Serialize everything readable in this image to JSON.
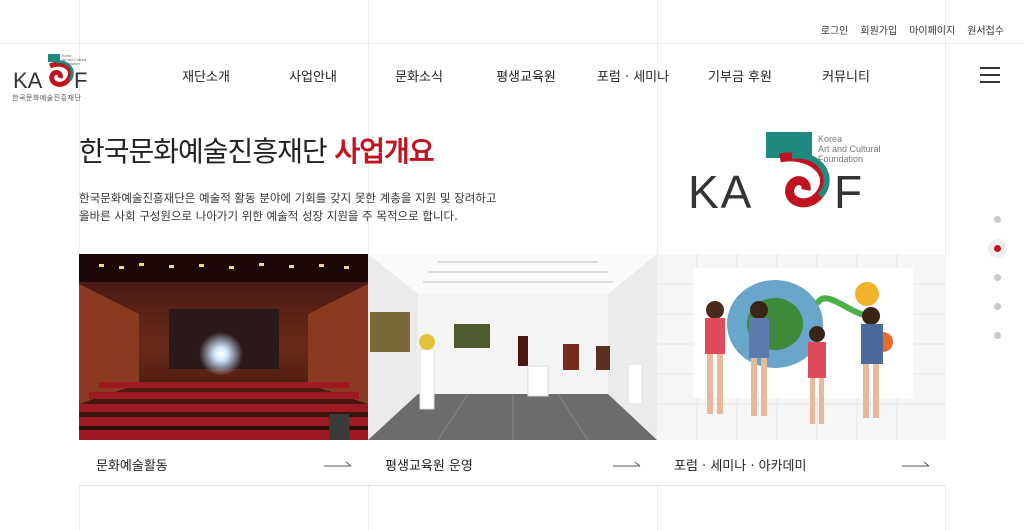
{
  "utility_links": [
    "로그인",
    "회원가입",
    "마이페이지",
    "원서접수"
  ],
  "brand": {
    "logo_text": "KACF",
    "logo_tagline": [
      "Korea",
      "Art and Cultural",
      "Foundation"
    ],
    "caption": "한국문화예술진흥재단"
  },
  "nav": {
    "items": [
      "재단소개",
      "사업안내",
      "문화소식",
      "평생교육원",
      "포럼 · 세미나",
      "기부금 후원",
      "커뮤니티"
    ]
  },
  "hero": {
    "title_main": "한국문화예술진흥재단",
    "title_accent": "사업개요",
    "description_line1": "한국문화예술진흥재단은 예술적 활동 분야에 기회를 갖지 못한 계층을 지원 및 장려하고",
    "description_line2": "올바른 사회 구성원으로 나아가기 위한 예술적 성장 지원을 주 목적으로 합니다."
  },
  "pagination": {
    "count": 5,
    "active": 2
  },
  "cards": [
    {
      "label": "문화예술활동",
      "icon": "arrow-right-icon"
    },
    {
      "label": "평생교육원 운영",
      "icon": "arrow-right-icon"
    },
    {
      "label": "포럼 · 세미나 · 아카데미",
      "icon": "arrow-right-icon"
    }
  ],
  "colors": {
    "accent": "#c1121f",
    "teal": "#1f8a80",
    "text": "#222222"
  }
}
